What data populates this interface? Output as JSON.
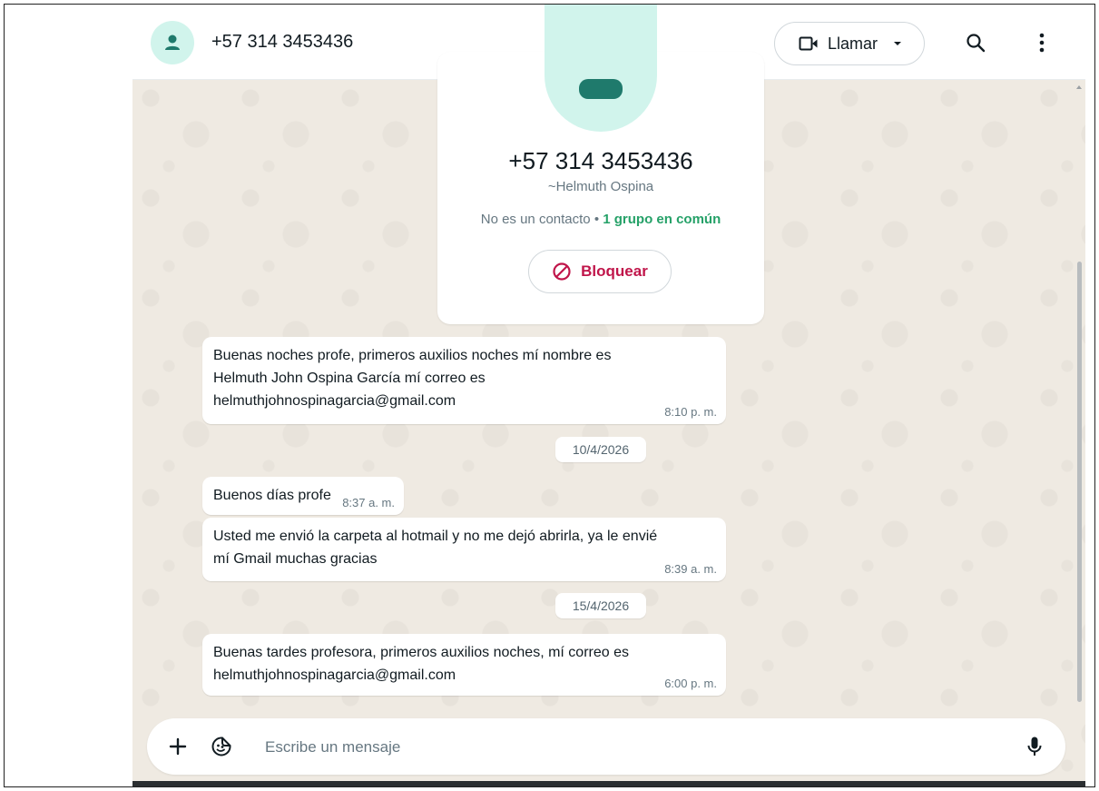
{
  "header": {
    "title": "+57 314 3453436",
    "call_label": "Llamar",
    "icons": [
      "avatar-person-icon",
      "video-icon",
      "chevron-down-icon",
      "search-icon",
      "menu-dots-icon"
    ]
  },
  "contact_card": {
    "number": "+57 314 3453436",
    "name": "~Helmuth Ospina",
    "status_prefix": "No es un contacto",
    "status_separator": " • ",
    "groups_text": "1 grupo en común",
    "block_label": "Bloquear"
  },
  "messages": [
    {
      "lines": [
        "Buenas noches profe, primeros auxilios noches mí nombre es",
        "Helmuth John Ospina García mí correo es",
        "helmuthjohnospinagarcia@gmail.com"
      ],
      "time": "8:10 p. m."
    },
    {
      "date_chip": "10/4/2026"
    },
    {
      "lines": [
        "Buenos días profe"
      ],
      "time": "8:37 a. m."
    },
    {
      "lines": [
        "Usted me envió la carpeta al hotmail y no me dejó abrirla, ya le envié",
        "mí Gmail muchas gracias"
      ],
      "time": "8:39 a. m."
    },
    {
      "date_chip": "15/4/2026"
    },
    {
      "lines": [
        "Buenas tardes profesora, primeros auxilios noches, mí correo es",
        "helmuthjohnospinagarcia@gmail.com"
      ],
      "time": "6:00 p. m."
    }
  ],
  "composer": {
    "placeholder": "Escribe un mensaje",
    "icons": [
      "plus-icon",
      "sticker-icon",
      "microphone-icon"
    ]
  },
  "colors": {
    "accent_green": "#25a168",
    "block_red": "#c0154a",
    "avatar_bg": "#d1f4ec",
    "avatar_fg": "#1f7a6c",
    "wallpaper": "#efeae2"
  }
}
